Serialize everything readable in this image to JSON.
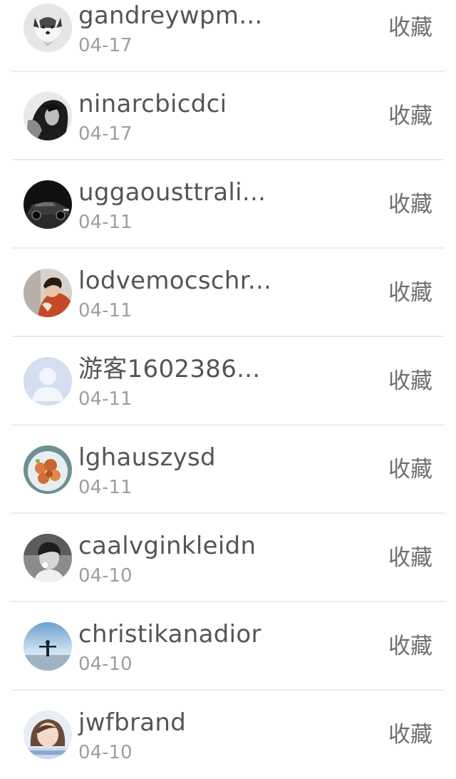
{
  "list": {
    "items": [
      {
        "name": "gandreywpm...",
        "date": "04-17",
        "action": "收藏",
        "avatar": "dog-avatar"
      },
      {
        "name": "ninarcbicdci",
        "date": "04-17",
        "action": "收藏",
        "avatar": "woman-bw-avatar"
      },
      {
        "name": "uggaousttrali...",
        "date": "04-11",
        "action": "收藏",
        "avatar": "car-avatar"
      },
      {
        "name": "lodvemocschr...",
        "date": "04-11",
        "action": "收藏",
        "avatar": "person-avatar"
      },
      {
        "name": "游客1602386...",
        "date": "04-11",
        "action": "收藏",
        "avatar": "default-avatar"
      },
      {
        "name": "lghauszysd",
        "date": "04-11",
        "action": "收藏",
        "avatar": "food-avatar"
      },
      {
        "name": "caalvginkleidn",
        "date": "04-10",
        "action": "收藏",
        "avatar": "boy-bw-avatar"
      },
      {
        "name": "christikanadior",
        "date": "04-10",
        "action": "收藏",
        "avatar": "sky-figure-avatar"
      },
      {
        "name": "jwfbrand",
        "date": "04-10",
        "action": "收藏",
        "avatar": "girl-avatar"
      }
    ]
  }
}
